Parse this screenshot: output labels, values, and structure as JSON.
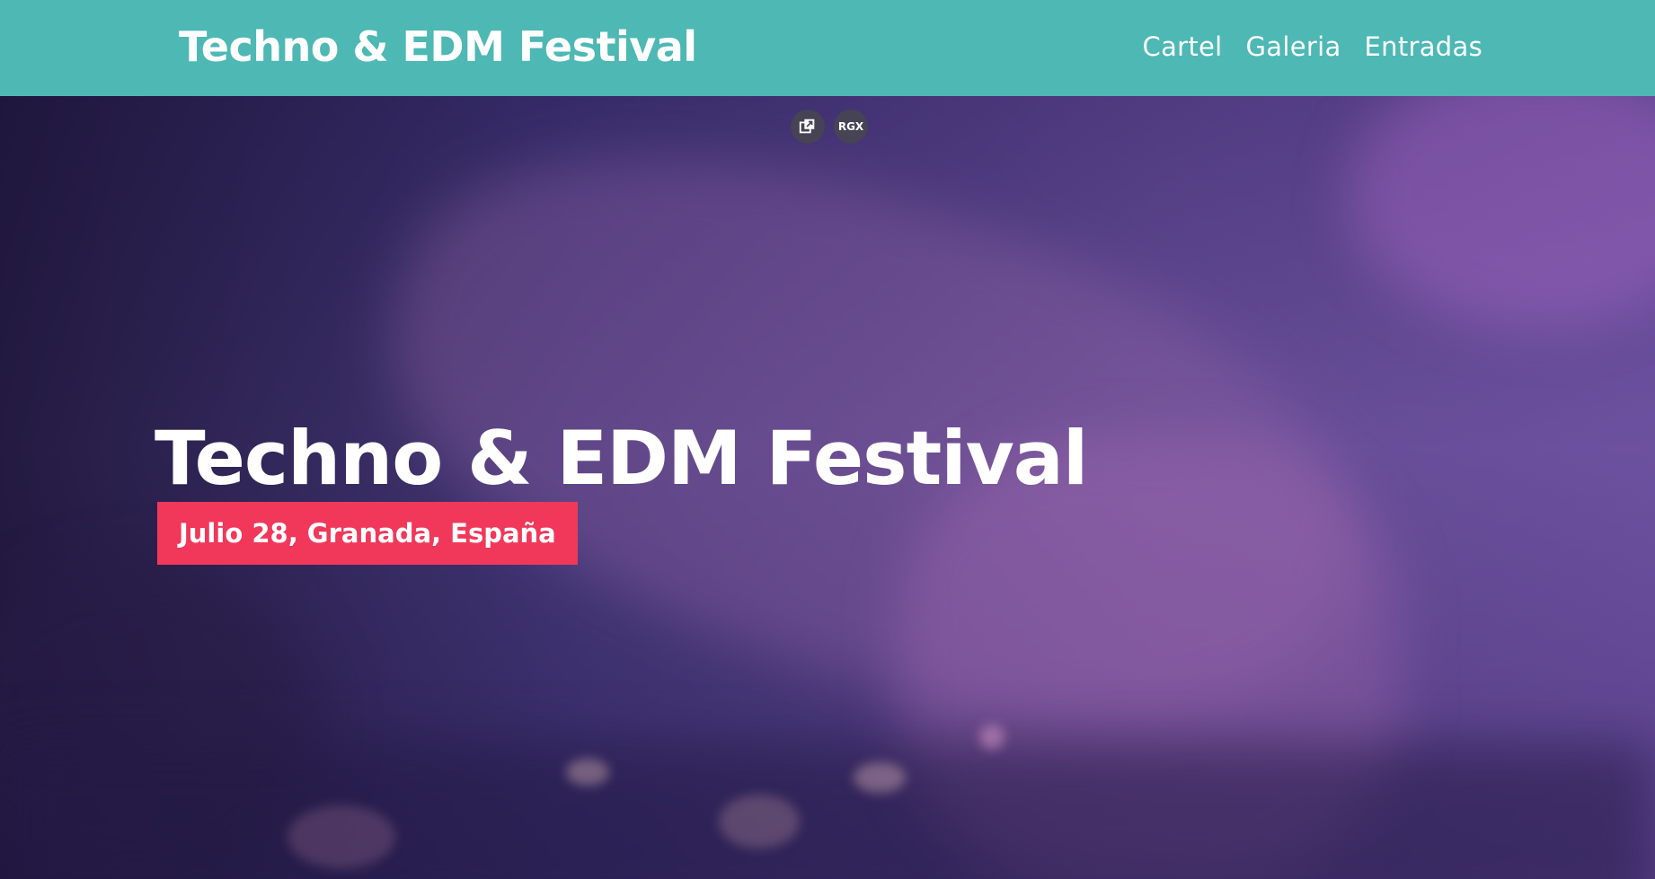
{
  "header": {
    "logo_text": "Techno & EDM Festival",
    "nav": [
      {
        "label": "Cartel"
      },
      {
        "label": "Galeria"
      },
      {
        "label": "Entradas"
      }
    ],
    "background_color": "#4db8b4"
  },
  "overlay": {
    "buttons": [
      {
        "icon": "external-window-icon"
      },
      {
        "label": "RGX"
      }
    ]
  },
  "hero": {
    "title": "Techno & EDM Festival",
    "date_location": "Julio 28, Granada, España",
    "badge_color": "#f2385a"
  }
}
